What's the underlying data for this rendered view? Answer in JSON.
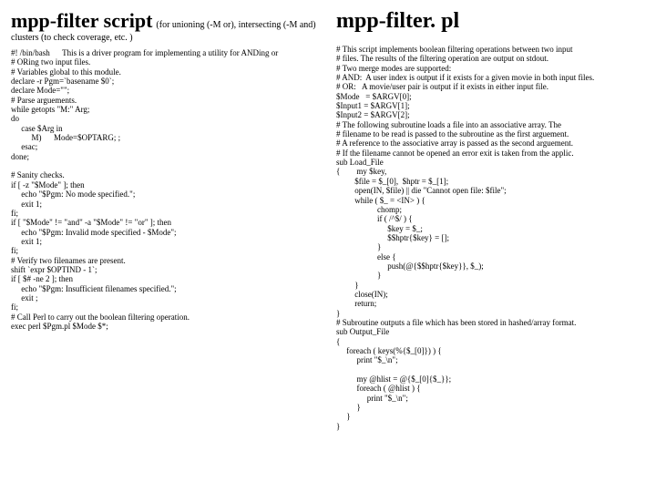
{
  "left": {
    "title": "mpp-filter script",
    "subtitle_inline": "(for unioning (-M or), intersecting (-M and)",
    "subtitle_below": "clusters (to check coverage, etc. )",
    "code": "#! /bin/bash      This is a driver program for implementing a utility for ANDing or\n# ORing two input files.\n# Variables global to this module.\ndeclare -r Pgm=`basename $0`;\ndeclare Mode=\"\";\n# Parse arguements.\nwhile getopts \"M:\" Arg;\ndo\n     case $Arg in\n          M)      Mode=$OPTARG; ;\n     esac;\ndone;\n\n# Sanity checks.\nif [ -z \"$Mode\" ]; then\n     echo \"$Pgm: No mode specified.\";\n     exit 1;\nfi;\nif [ \"$Mode\" != \"and\" -a \"$Mode\" != \"or\" ]; then\n     echo \"$Pgm: Invalid mode specified - $Mode\";\n     exit 1;\nfi;\n# Verify two filenames are present.\nshift `expr $OPTIND - 1`;\nif [ $# -ne 2 ]; then\n     echo \"$Pgm: Insufficient filenames specified.\";\n     exit ;\nfi;\n# Call Perl to carry out the boolean filtering operation.\nexec perl $Pgm.pl $Mode $*;"
  },
  "right": {
    "title": "mpp-filter. pl",
    "code": "# This script implements boolean filtering operations between two input\n# files. The results of the filtering operation are output on stdout.\n# Two merge modes are supported:\n# AND:  A user index is output if it exists for a given movie in both input files.\n# OR:   A movie/user pair is output if it exists in either input file.\n$Mode   = $ARGV[0];\n$Input1 = $ARGV[1];\n$Input2 = $ARGV[2];\n# The following subroutine loads a file into an associative array. The\n# filename to be read is passed to the subroutine as the first arguement.\n# A reference to the associative array is passed as the second arguement.\n# If the filename cannot be opened an error exit is taken from the applic.\nsub Load_File\n{        my $key,\n         $file = $_[0],  $hptr = $_[1];\n         open(IN, $file) || die \"Cannot open file: $file\";\n         while ( $_ = <IN> ) {\n                    chomp;\n                    if ( /^$/ ) {\n                         $key = $_;\n                         $$hptr{$key} = [];\n                    }\n                    else {\n                         push(@{$$hptr{$key}}, $_);\n                    }\n         }\n         close(IN);\n         return;\n}\n# Subroutine outputs a file which has been stored in hashed/array format.\nsub Output_File\n{\n     foreach ( keys(%{$_[0]}) ) {\n          print \"$_\\n\";\n\n          my @hlist = @{$_[0]{$_}};\n          foreach ( @hlist ) {\n               print \"$_\\n\";\n          }\n     }\n}"
  }
}
